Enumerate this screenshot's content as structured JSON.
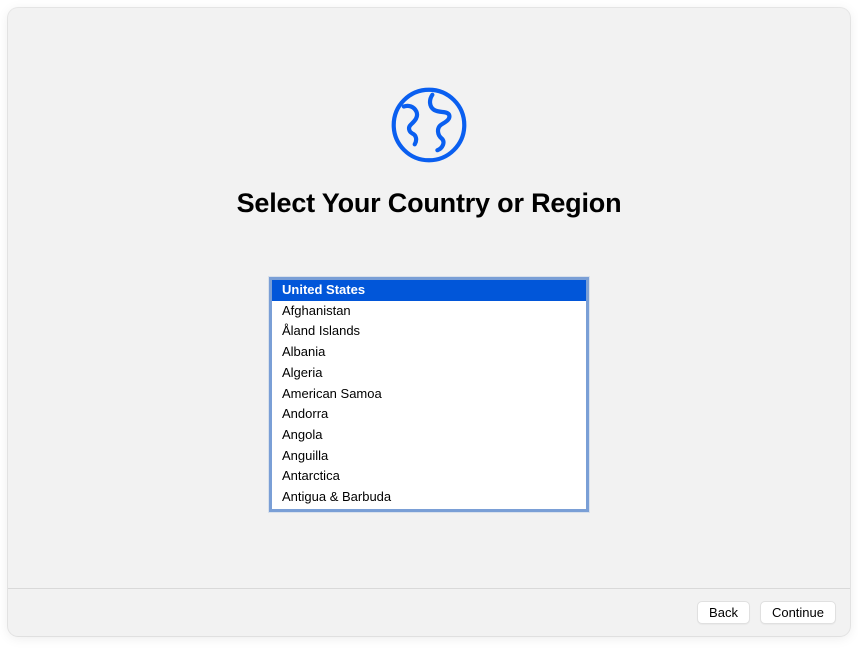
{
  "title": "Select Your Country or Region",
  "icon_color": "#0a5ff0",
  "list": {
    "selected_index": 0,
    "items": [
      "United States",
      "Afghanistan",
      "Åland Islands",
      "Albania",
      "Algeria",
      "American Samoa",
      "Andorra",
      "Angola",
      "Anguilla",
      "Antarctica",
      "Antigua & Barbuda"
    ]
  },
  "footer": {
    "back_label": "Back",
    "continue_label": "Continue"
  }
}
